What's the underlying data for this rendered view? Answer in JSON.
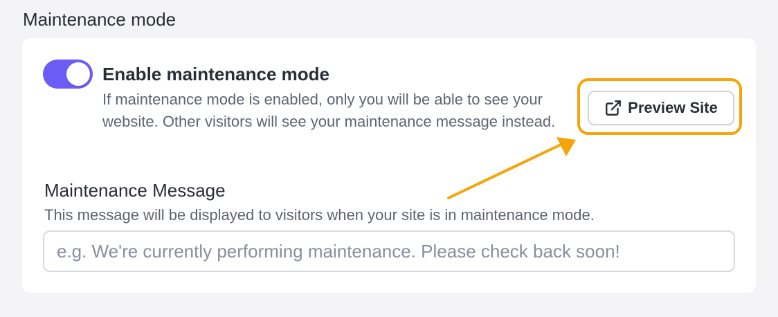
{
  "section": {
    "title": "Maintenance mode"
  },
  "maintenance_toggle": {
    "enabled": true,
    "title": "Enable maintenance mode",
    "description": "If maintenance mode is enabled, only you will be able to see your website. Other visitors will see your maintenance message instead."
  },
  "preview_button": {
    "label": "Preview Site",
    "icon": "external-link-icon"
  },
  "message_field": {
    "label": "Maintenance Message",
    "help": "This message will be displayed to visitors when your site is in maintenance mode.",
    "value": "",
    "placeholder": "e.g. We're currently performing maintenance. Please check back soon!"
  },
  "colors": {
    "accent": "#6b5cf6",
    "annotation": "#f5a50a"
  }
}
